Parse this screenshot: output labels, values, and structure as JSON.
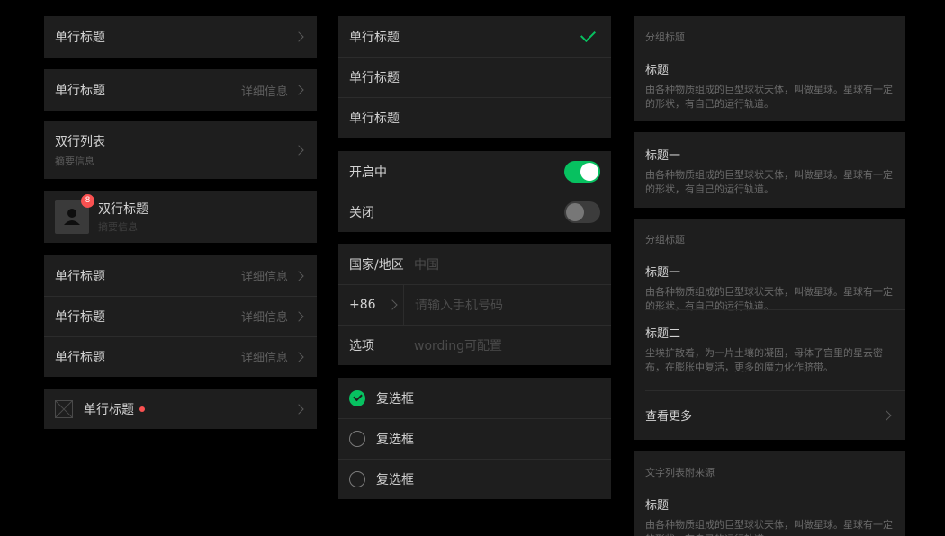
{
  "colors": {
    "background": "#000000",
    "card": "#1e1e1e",
    "accent_green": "#07c160",
    "badge_red": "#fa5151"
  },
  "col1": {
    "item1": {
      "title": "单行标题"
    },
    "item2": {
      "title": "单行标题",
      "detail": "详细信息"
    },
    "item3": {
      "title": "双行列表",
      "subtitle": "摘要信息"
    },
    "item4": {
      "title": "双行标题",
      "subtitle": "摘要信息",
      "badge": "8",
      "avatar_icon": "person-icon"
    },
    "group": [
      {
        "title": "单行标题",
        "detail": "详细信息"
      },
      {
        "title": "单行标题",
        "detail": "详细信息"
      },
      {
        "title": "单行标题",
        "detail": "详细信息"
      }
    ],
    "item6": {
      "title": "单行标题",
      "icon": "image-placeholder-icon"
    }
  },
  "col2": {
    "select_list": [
      {
        "title": "单行标题",
        "selected": true
      },
      {
        "title": "单行标题",
        "selected": false
      },
      {
        "title": "单行标题",
        "selected": false
      }
    ],
    "switches": [
      {
        "label": "开启中",
        "on": true
      },
      {
        "label": "关闭",
        "on": false
      }
    ],
    "form": {
      "region_label": "国家/地区",
      "region_value": "中国",
      "code": "+86",
      "phone_placeholder": "请输入手机号码",
      "option_label": "选项",
      "option_placeholder": "wording可配置"
    },
    "checkboxes": [
      {
        "label": "复选框",
        "checked": true
      },
      {
        "label": "复选框",
        "checked": false
      },
      {
        "label": "复选框",
        "checked": false
      }
    ]
  },
  "col3": {
    "card1": {
      "group_title": "分组标题",
      "title": "标题",
      "desc": "由各种物质组成的巨型球状天体，叫做星球。星球有一定的形状，有自己的运行轨道。"
    },
    "card2": {
      "title": "标题一",
      "desc": "由各种物质组成的巨型球状天体，叫做星球。星球有一定的形状，有自己的运行轨道。"
    },
    "card3": {
      "group_title": "分组标题",
      "item1_title": "标题一",
      "item1_desc": "由各种物质组成的巨型球状天体，叫做星球。星球有一定的形状，有自己的运行轨道。",
      "item2_title": "标题二",
      "item2_desc": "尘埃扩散着，为一片土壤的凝固，母体子宫里的星云密布，在膨胀中复活，更多的魔力化作脐带。",
      "more": "查看更多"
    },
    "card4": {
      "group_title": "文字列表附来源",
      "title": "标题",
      "desc": "由各种物质组成的巨型球状天体，叫做星球。星球有一定的形状，有自己的运行轨道。"
    }
  }
}
